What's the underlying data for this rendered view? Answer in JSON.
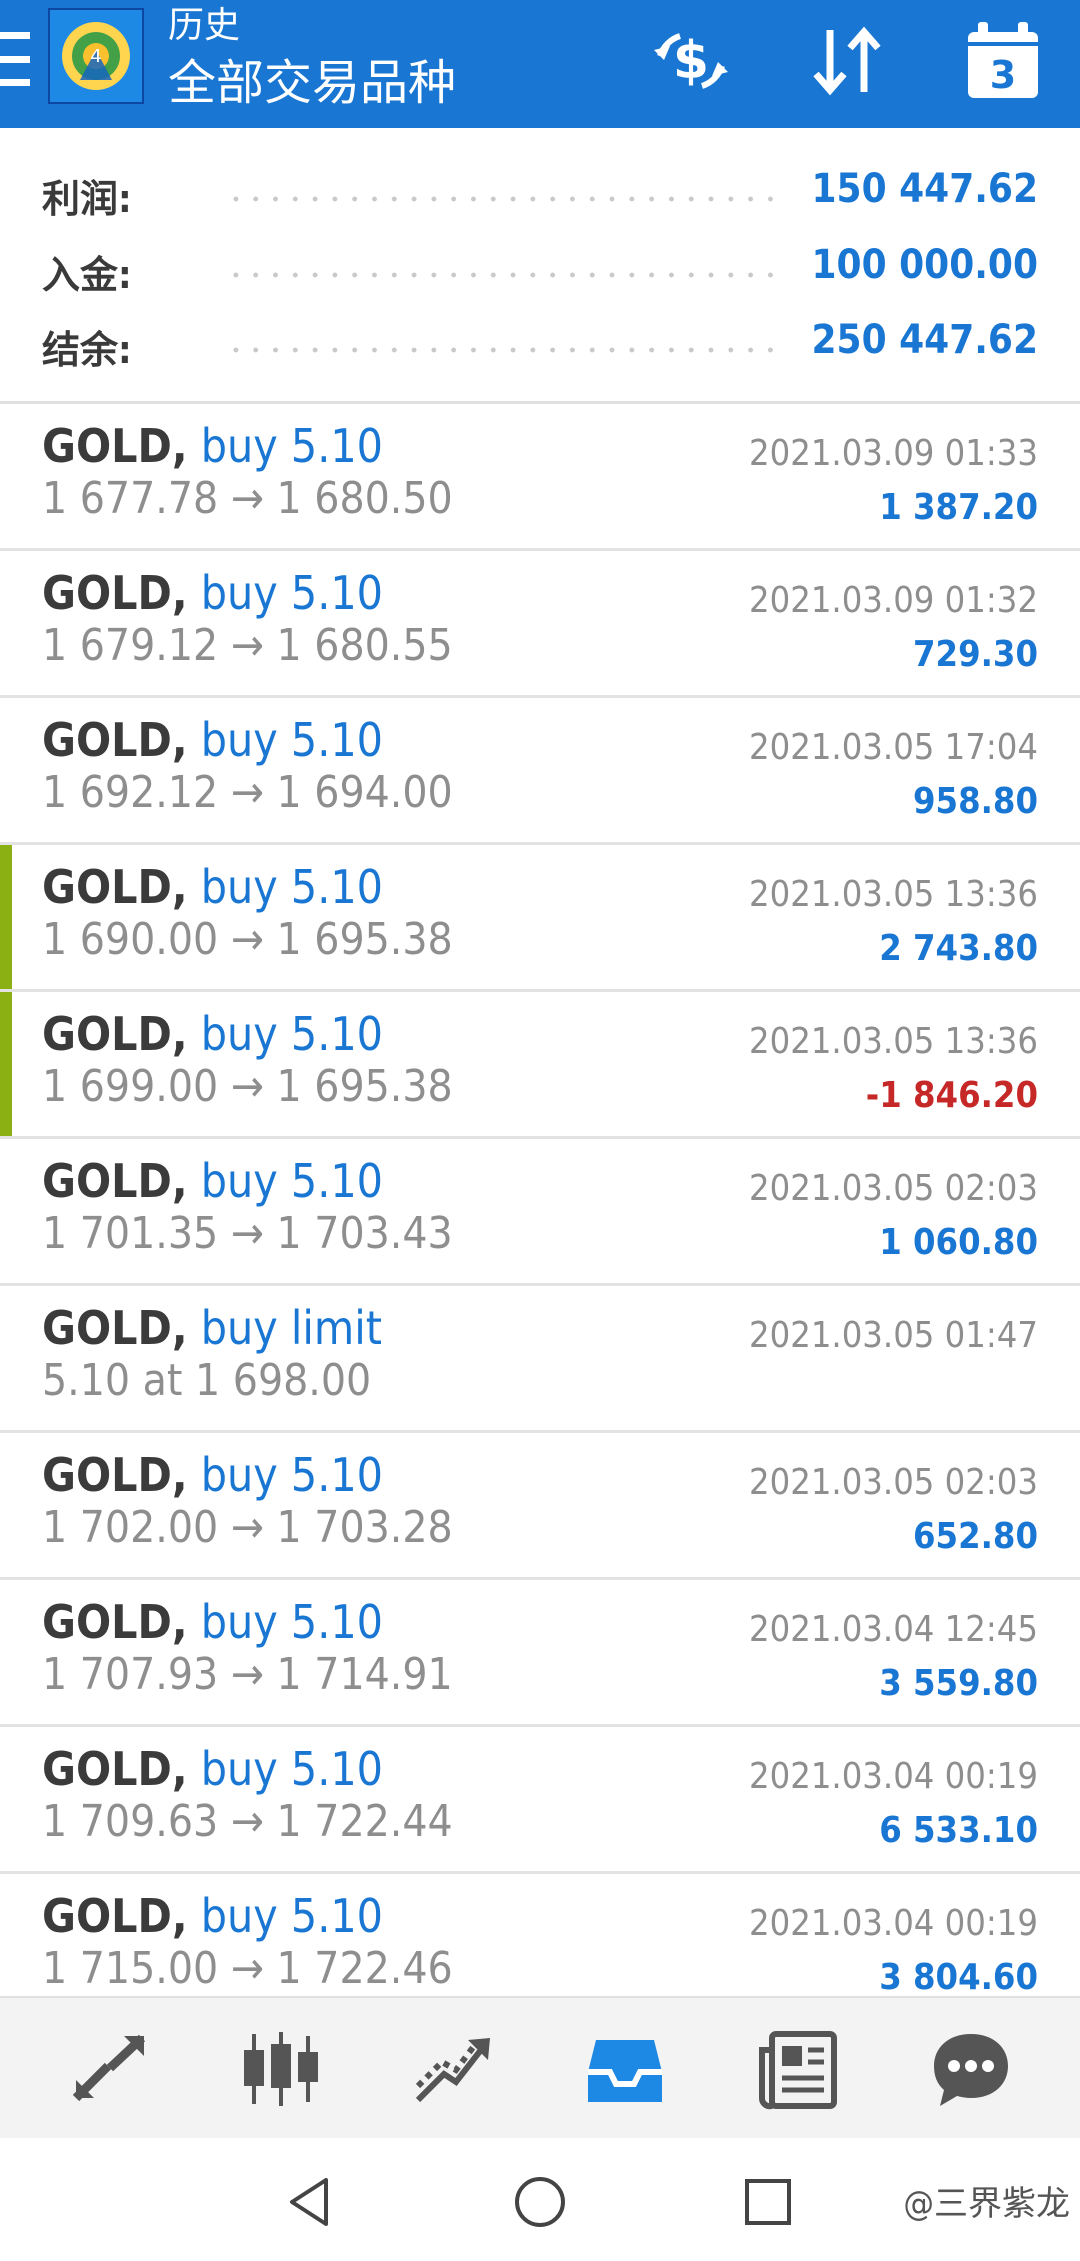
{
  "header": {
    "subtitle": "历史",
    "title": "全部交易品种",
    "calendar_day": "3"
  },
  "summary": [
    {
      "label": "利润:",
      "value": "150 447.62"
    },
    {
      "label": "入金:",
      "value": "100 000.00"
    },
    {
      "label": "结余:",
      "value": "250 447.62"
    }
  ],
  "trades": [
    {
      "symbol": "GOLD,",
      "action": "buy 5.10",
      "prices": "1 677.78 → 1 680.50",
      "time": "2021.03.09 01:33",
      "profit": "1 387.20",
      "flagged": false,
      "negative": false
    },
    {
      "symbol": "GOLD,",
      "action": "buy 5.10",
      "prices": "1 679.12 → 1 680.55",
      "time": "2021.03.09 01:32",
      "profit": "729.30",
      "flagged": false,
      "negative": false
    },
    {
      "symbol": "GOLD,",
      "action": "buy 5.10",
      "prices": "1 692.12 → 1 694.00",
      "time": "2021.03.05 17:04",
      "profit": "958.80",
      "flagged": false,
      "negative": false
    },
    {
      "symbol": "GOLD,",
      "action": "buy 5.10",
      "prices": "1 690.00 → 1 695.38",
      "time": "2021.03.05 13:36",
      "profit": "2 743.80",
      "flagged": true,
      "negative": false
    },
    {
      "symbol": "GOLD,",
      "action": "buy 5.10",
      "prices": "1 699.00 → 1 695.38",
      "time": "2021.03.05 13:36",
      "profit": "-1 846.20",
      "flagged": true,
      "negative": true
    },
    {
      "symbol": "GOLD,",
      "action": "buy 5.10",
      "prices": "1 701.35 → 1 703.43",
      "time": "2021.03.05 02:03",
      "profit": "1 060.80",
      "flagged": false,
      "negative": false
    },
    {
      "symbol": "GOLD,",
      "action": "buy limit",
      "prices": "5.10 at 1 698.00",
      "time": "2021.03.05 01:47",
      "profit": "",
      "flagged": false,
      "negative": false
    },
    {
      "symbol": "GOLD,",
      "action": "buy 5.10",
      "prices": "1 702.00 → 1 703.28",
      "time": "2021.03.05 02:03",
      "profit": "652.80",
      "flagged": false,
      "negative": false
    },
    {
      "symbol": "GOLD,",
      "action": "buy 5.10",
      "prices": "1 707.93 → 1 714.91",
      "time": "2021.03.04 12:45",
      "profit": "3 559.80",
      "flagged": false,
      "negative": false
    },
    {
      "symbol": "GOLD,",
      "action": "buy 5.10",
      "prices": "1 709.63 → 1 722.44",
      "time": "2021.03.04 00:19",
      "profit": "6 533.10",
      "flagged": false,
      "negative": false
    },
    {
      "symbol": "GOLD,",
      "action": "buy 5.10",
      "prices": "1 715.00 → 1 722.46",
      "time": "2021.03.04 00:19",
      "profit": "3 804.60",
      "flagged": false,
      "negative": false
    }
  ],
  "bottom_nav": [
    {
      "icon": "quotes-icon",
      "active": false
    },
    {
      "icon": "chart-icon",
      "active": false
    },
    {
      "icon": "trade-icon",
      "active": false
    },
    {
      "icon": "history-icon",
      "active": true
    },
    {
      "icon": "news-icon",
      "active": false
    },
    {
      "icon": "chat-icon",
      "active": false
    }
  ],
  "system_nav": [
    "back-icon",
    "home-icon",
    "recents-icon"
  ],
  "watermark": "@三界紫龙",
  "colors": {
    "appbar": "#1976d2",
    "accent": "#1976d2",
    "negative": "#c62828",
    "flag": "#8bb014",
    "muted": "#8e8e8e"
  }
}
